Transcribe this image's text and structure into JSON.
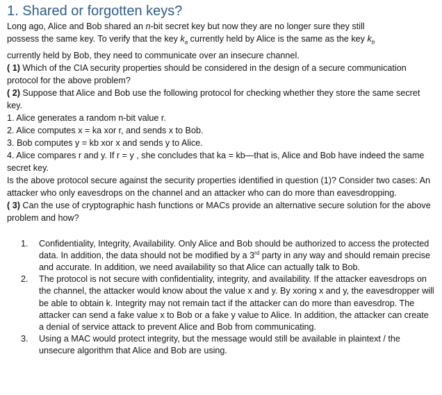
{
  "title": "1. Shared or forgotten keys?",
  "intro": {
    "l1a": "Long ago, Alice and Bob shared an ",
    "l1b": "n",
    "l1c": "-bit secret key but now they are no longer sure they still",
    "l2a": "possess the same key. To verify that the key ",
    "l2b": "k",
    "l2c": "a",
    "l2d": " currently held by Alice is the same as the key ",
    "l2e": "k",
    "l2f": "b",
    "l3": "currently held by Bob, they need to communicate over an insecure channel."
  },
  "q1": {
    "num": "( 1)",
    "text": " Which of the CIA security properties should be considered in the design of a secure communication protocol for the above problem?"
  },
  "q2": {
    "num": "( 2)",
    "text": " Suppose that Alice and Bob use the following protocol for checking whether they store the same secret key."
  },
  "steps": [
    "1. Alice generates a random n-bit value r.",
    "2. Alice computes x = ka xor r, and sends x to Bob.",
    "3. Bob computes y = kb xor x and sends y to Alice.",
    "4. Alice compares r and y. If r = y , she concludes that ka = kb—that is, Alice and Bob have indeed the same secret key."
  ],
  "q2_follow": "Is the above protocol secure against the security properties identified in question (1)? Consider two cases: An attacker who only eavesdrops on the channel and an attacker who can do more than eavesdropping.",
  "q3": {
    "num": "( 3)",
    "text": " Can the use of cryptographic hash functions or MACs provide an alternative secure solution for the above problem and how?"
  },
  "answers": [
    {
      "num": "1.",
      "text_a": "Confidentiality, Integrity, Availability. Only Alice and Bob should be authorized to access the protected data. In addition, the data should not be modified by a 3",
      "sup": "rd",
      "text_b": " party in any way and should remain precise and accurate. In addition, we need availability so that Alice can actually talk to Bob."
    },
    {
      "num": "2.",
      "text_a": "The protocol is not secure with confidentiality, integrity, and availability. If the attacker eavesdrops on the channel, the attacker would know about the value x and y. By xoring x and y, the eavesdropper will be able to obtain k. Integrity may not remain tact if the attacker can do more than eavesdrop. The attacker can send a fake value x to Bob or a fake y value to Alice. In addition, the attacker can create a denial of service attack to prevent Alice and Bob from communicating.",
      "sup": "",
      "text_b": ""
    },
    {
      "num": "3.",
      "text_a": "Using a MAC would protect integrity, but the message would still be available in plaintext / the unsecure algorithm that Alice and Bob are using.",
      "sup": "",
      "text_b": ""
    }
  ]
}
